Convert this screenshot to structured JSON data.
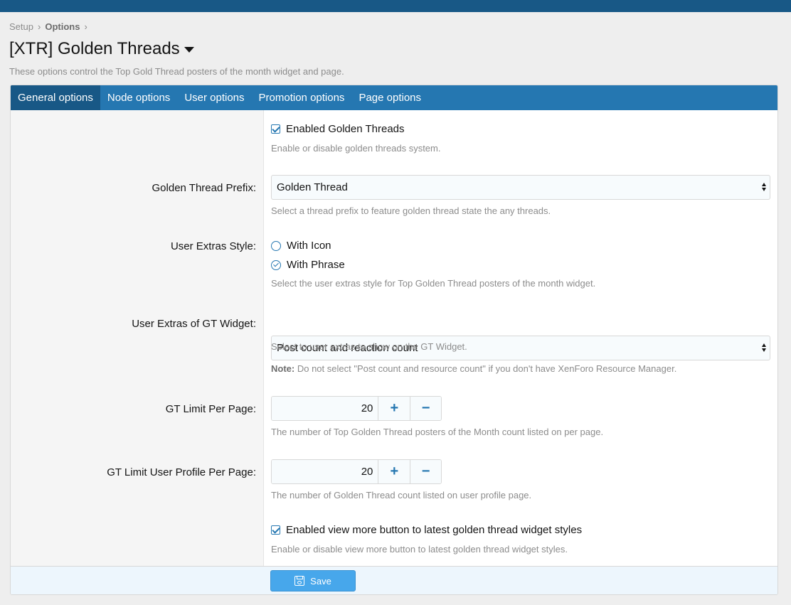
{
  "breadcrumb": {
    "items": [
      "Setup",
      "Options"
    ],
    "sep": "›"
  },
  "page": {
    "title": "[XTR] Golden Threads",
    "description": "These options control the Top Gold Thread posters of the month widget and page."
  },
  "tabs": [
    "General options",
    "Node options",
    "User options",
    "Promotion options",
    "Page options"
  ],
  "options": {
    "enabled": {
      "label": "Enabled Golden Threads",
      "checked": true,
      "hint": "Enable or disable golden threads system."
    },
    "prefix": {
      "label": "Golden Thread Prefix:",
      "value": "Golden Thread",
      "hint": "Select a thread prefix to feature golden thread state the any threads."
    },
    "extras_style": {
      "label": "User Extras Style:",
      "choices": [
        "With Icon",
        "With Phrase"
      ],
      "selected": "With Phrase",
      "hint": "Select the user extras style for Top Golden Thread posters of the month widget."
    },
    "extras_widget": {
      "label": "User Extras of GT Widget:",
      "value": "Post count and reaction count",
      "hint": "Select to user extras to show on the GT Widget.",
      "note_label": "Note:",
      "note": "Do not select \"Post count and resource count\" if you don't have XenForo Resource Manager."
    },
    "limit_page": {
      "label": "GT Limit Per Page:",
      "value": "20",
      "hint": "The number of Top Golden Thread posters of the Month count listed on per page."
    },
    "limit_profile": {
      "label": "GT Limit User Profile Per Page:",
      "value": "20",
      "hint": "The number of Golden Thread count listed on user profile page."
    },
    "view_more": {
      "label": "Enabled view more button to latest golden thread widget styles",
      "checked": true,
      "hint": "Enable or disable view more button to latest golden thread widget styles."
    }
  },
  "stepper": {
    "plus": "+",
    "minus": "−"
  },
  "footer": {
    "save_label": "Save"
  },
  "colors": {
    "topbar": "#185886",
    "tabs": "#2577b1",
    "save": "#47a7eb"
  }
}
